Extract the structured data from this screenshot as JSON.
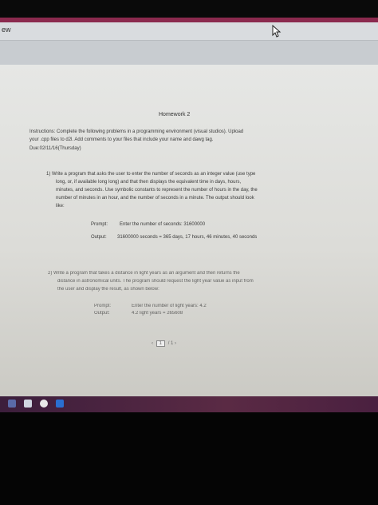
{
  "toolbar": {
    "menu_label": "ew"
  },
  "document": {
    "title": "Homework 2",
    "instructions": [
      "Instructions: Complete the following problems in a programming environment (visual studios). Upload",
      "your .cpp files to d2l.  Add comments to your files that include your name and dawg tag.",
      "Due:02/11/16(Thursday)"
    ],
    "problem1": {
      "lines": [
        "1)   Write a program that asks the user to enter the number of seconds as an integer value (use type",
        "long, or, if available long long) and that then displays the equivalent time in days, hours,",
        "minutes, and seconds. Use symbolic constants to represent the number of hours in the day, the",
        "number of minutes in an hour, and the number of seconds in a minute. The output should look",
        "like:"
      ],
      "prompt_label": "Prompt:",
      "prompt_text": "Enter the number of seconds: 31600000",
      "output_label": "Output:",
      "output_text": "31600000 seconds = 365 days, 17 hours, 46 minutes, 40 seconds"
    },
    "problem2": {
      "lines": [
        "2)   Write a program that takes a distance in light years as an argument and then returns the",
        "distance in astronomical units. The program should request the light year value as input from",
        "the user and display the result, as shown below:"
      ],
      "prompt_label": "Prompt:",
      "prompt_text": "Enter the number of light years: 4.2",
      "output_label": "Output:",
      "output_text": "4.2 light years = 265608"
    },
    "pager": {
      "current": "1",
      "total": "/ 1"
    }
  }
}
